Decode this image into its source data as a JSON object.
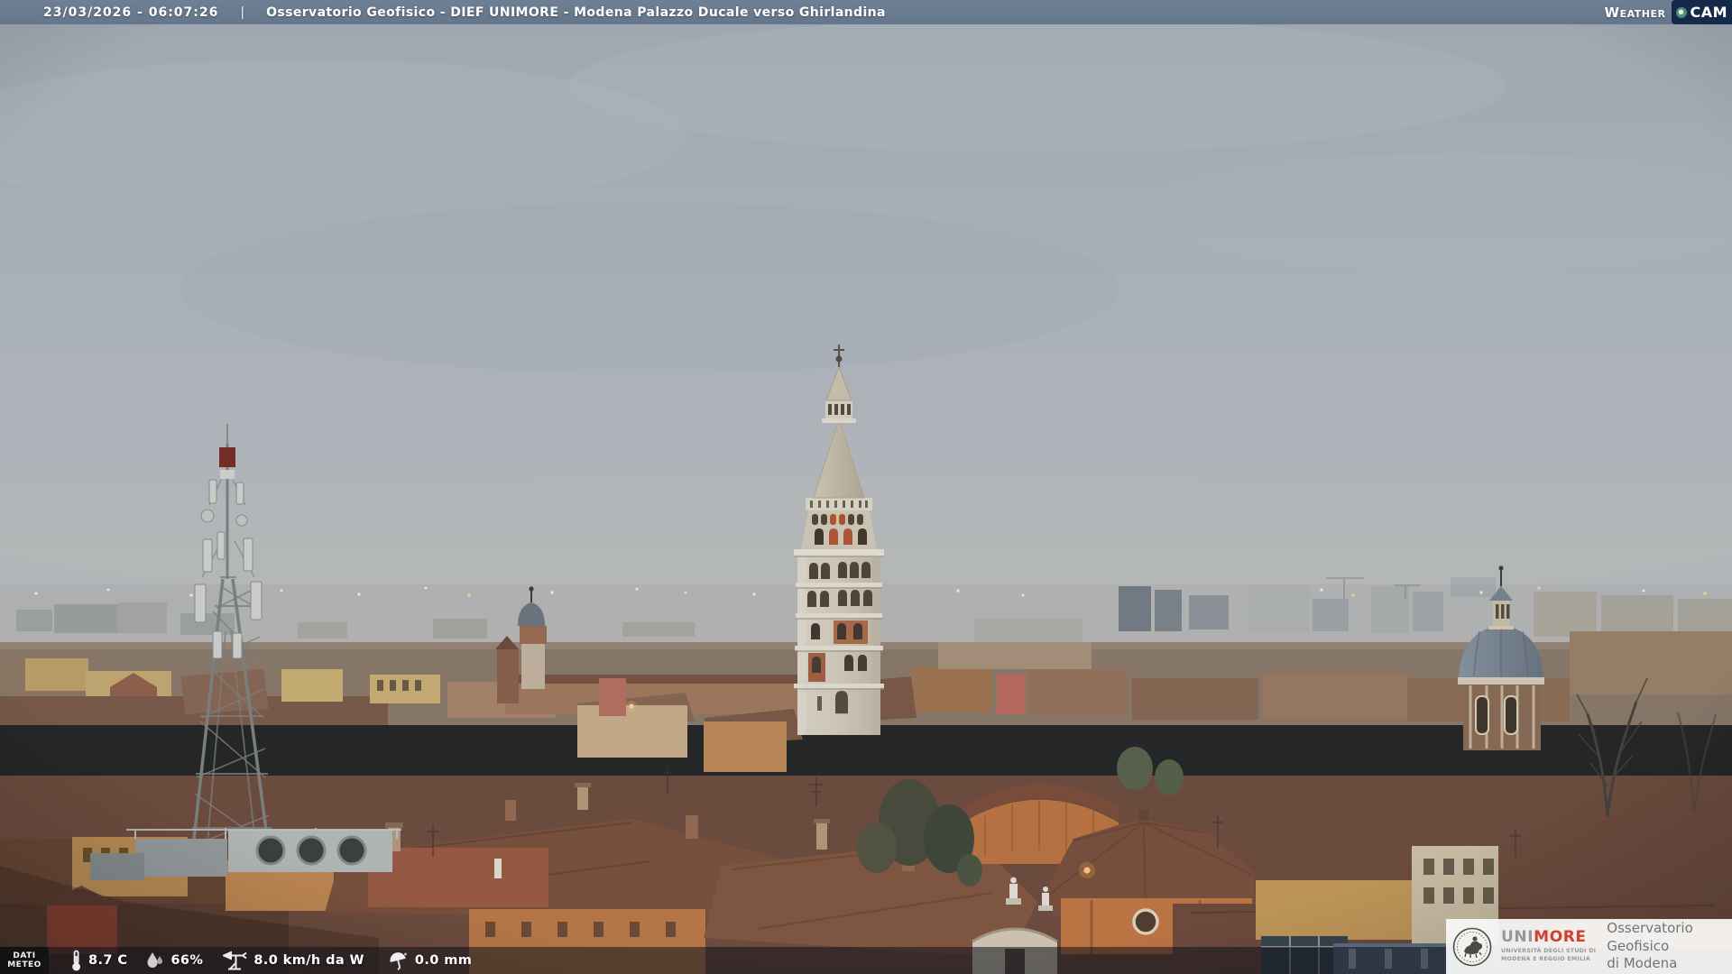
{
  "header": {
    "timestamp": "23/03/2026 - 06:07:26",
    "separator": "|",
    "title": "Osservatorio Geofisico - DIEF UNIMORE - Modena Palazzo Ducale verso Ghirlandina",
    "logo": {
      "weather": "Weather",
      "cam": "CAM"
    },
    "bar_color": "#65788c",
    "logo_navy_color": "#16294a"
  },
  "meteo": {
    "label_line1": "DATI",
    "label_line2": "METEO",
    "items": [
      {
        "icon": "thermometer-icon",
        "value": "8.7 C"
      },
      {
        "icon": "humidity-icon",
        "value": "66%"
      },
      {
        "icon": "wind-icon",
        "value": "8.0 km/h da W"
      },
      {
        "icon": "rain-icon",
        "value": "0.0 mm"
      }
    ]
  },
  "branding": {
    "uni": "UNI",
    "more": "MORE",
    "sub_line1": "UNIVERSITÀ DEGLI STUDI DI",
    "sub_line2": "MODENA E REGGIO EMILIA",
    "org_line1": "Osservatorio Geofisico",
    "org_line2": "di Modena",
    "more_color": "#cf4030"
  },
  "scene": {
    "palette": {
      "sky_top": "#a6afb8",
      "sky_horizon": "#bfc0bd",
      "roofs": "#7c4f39",
      "wall_orange": "#bf7a44",
      "wall_yellow": "#c79a57",
      "tower_stone": "#d8d0bf",
      "dome_lead": "#76818d"
    }
  }
}
